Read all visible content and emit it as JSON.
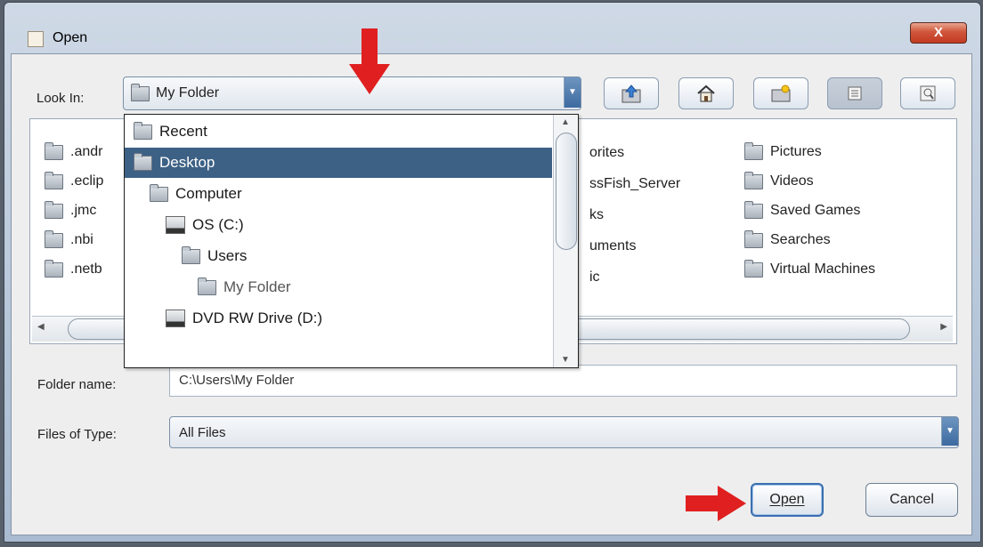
{
  "window": {
    "title": "Open",
    "close_glyph": "X"
  },
  "look_in": {
    "label": "Look In:",
    "value": "My Folder"
  },
  "toolbar": {
    "icons": [
      "up-one-level-icon",
      "home-icon",
      "new-folder-icon",
      "list-view-icon",
      "details-view-icon"
    ]
  },
  "dropdown": {
    "items": [
      {
        "label": "Recent",
        "icon": "folder-icon"
      },
      {
        "label": "Desktop",
        "icon": "folder-icon"
      },
      {
        "label": "Computer",
        "icon": "folder-icon"
      },
      {
        "label": "OS (C:)",
        "icon": "drive-icon"
      },
      {
        "label": "Users",
        "icon": "folder-icon"
      },
      {
        "label": "My Folder",
        "icon": "folder-icon"
      },
      {
        "label": "DVD RW Drive (D:)",
        "icon": "drive-icon"
      }
    ],
    "selected": "Desktop"
  },
  "file_list": {
    "col1": [
      ".andr",
      ".eclip",
      ".jmc",
      ".nbi",
      ".netb"
    ],
    "col2": [
      "orites",
      "ssFish_Server",
      "ks",
      "uments",
      "ic"
    ],
    "col3": [
      "Pictures",
      "Videos",
      "Saved Games",
      "Searches",
      "Virtual Machines"
    ]
  },
  "folder_name": {
    "label": "Folder name:",
    "value": "C:\\Users\\My Folder"
  },
  "files_of_type": {
    "label": "Files of Type:",
    "value": "All Files"
  },
  "buttons": {
    "open": "Open",
    "cancel": "Cancel"
  },
  "colors": {
    "selection": "#3d6185",
    "annotation_arrow": "#e02020"
  }
}
